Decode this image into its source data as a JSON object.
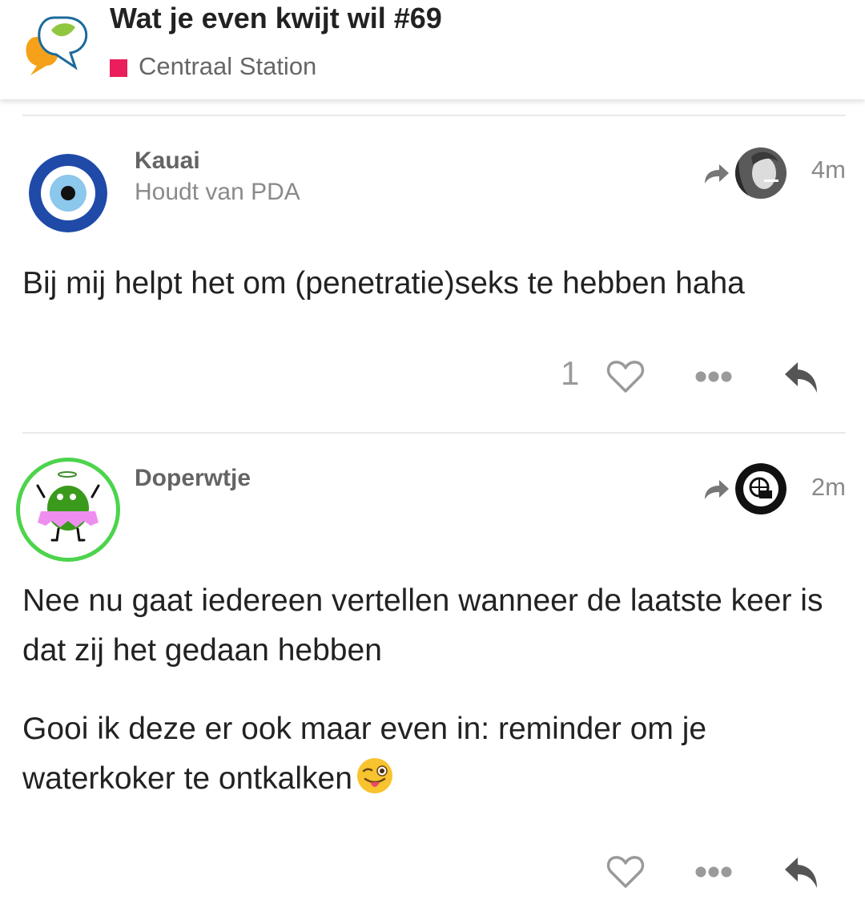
{
  "header": {
    "topic_title": "Wat je even kwijt wil #69",
    "category": "Centraal Station",
    "category_color": "#e91e5a"
  },
  "posts": [
    {
      "username": "Kauai",
      "user_title": "Houdt van PDA",
      "reply_to_avatar": "reply-to-user-avatar",
      "time": "4m",
      "body": [
        "Bij mij helpt het om (penetratie)seks te hebben haha"
      ],
      "like_count": "1"
    },
    {
      "username": "Doperwtje",
      "user_title": "",
      "reply_to_avatar": "reply-to-user-avatar",
      "time": "2m",
      "body": [
        "Nee nu gaat iedereen vertellen wanneer de laatste keer is dat zij het gedaan hebben",
        "Gooi ik deze er ook maar even in: reminder om je waterkoker te ontkalken"
      ],
      "body_emoji": "winking-face-with-tongue-emoji",
      "like_count": ""
    }
  ],
  "icons": {
    "reply_arrow": "reply-arrow-icon",
    "like": "heart-icon",
    "more": "more-dots-icon",
    "reply": "reply-icon"
  },
  "colors": {
    "text": "#222222",
    "muted": "#8a8a8a",
    "icon": "#9a9a9a",
    "avatar_ring_green": "#4cd44c"
  }
}
